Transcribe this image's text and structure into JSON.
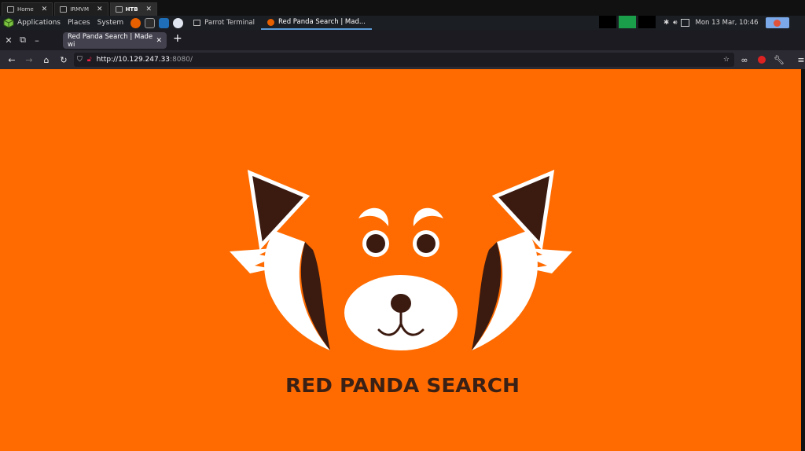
{
  "vm_tabs": [
    {
      "label": "Home"
    },
    {
      "label": "IRMVM"
    },
    {
      "label": "HTB"
    }
  ],
  "panel": {
    "menus": [
      "Applications",
      "Places",
      "System"
    ],
    "tasks": [
      {
        "label": "Parrot Terminal"
      },
      {
        "label": "Red Panda Search | Mad..."
      }
    ],
    "clock": "Mon 13 Mar, 10:46"
  },
  "browser": {
    "tab_title": "Red Panda Search | Made wi",
    "url_host": "http://10.129.247.33",
    "url_port": ":8080/"
  },
  "page": {
    "logo_text": "RED PANDA SEARCH",
    "colors": {
      "background": "#ff6b00",
      "dark_brown": "#3b1a10",
      "white": "#ffffff"
    }
  }
}
